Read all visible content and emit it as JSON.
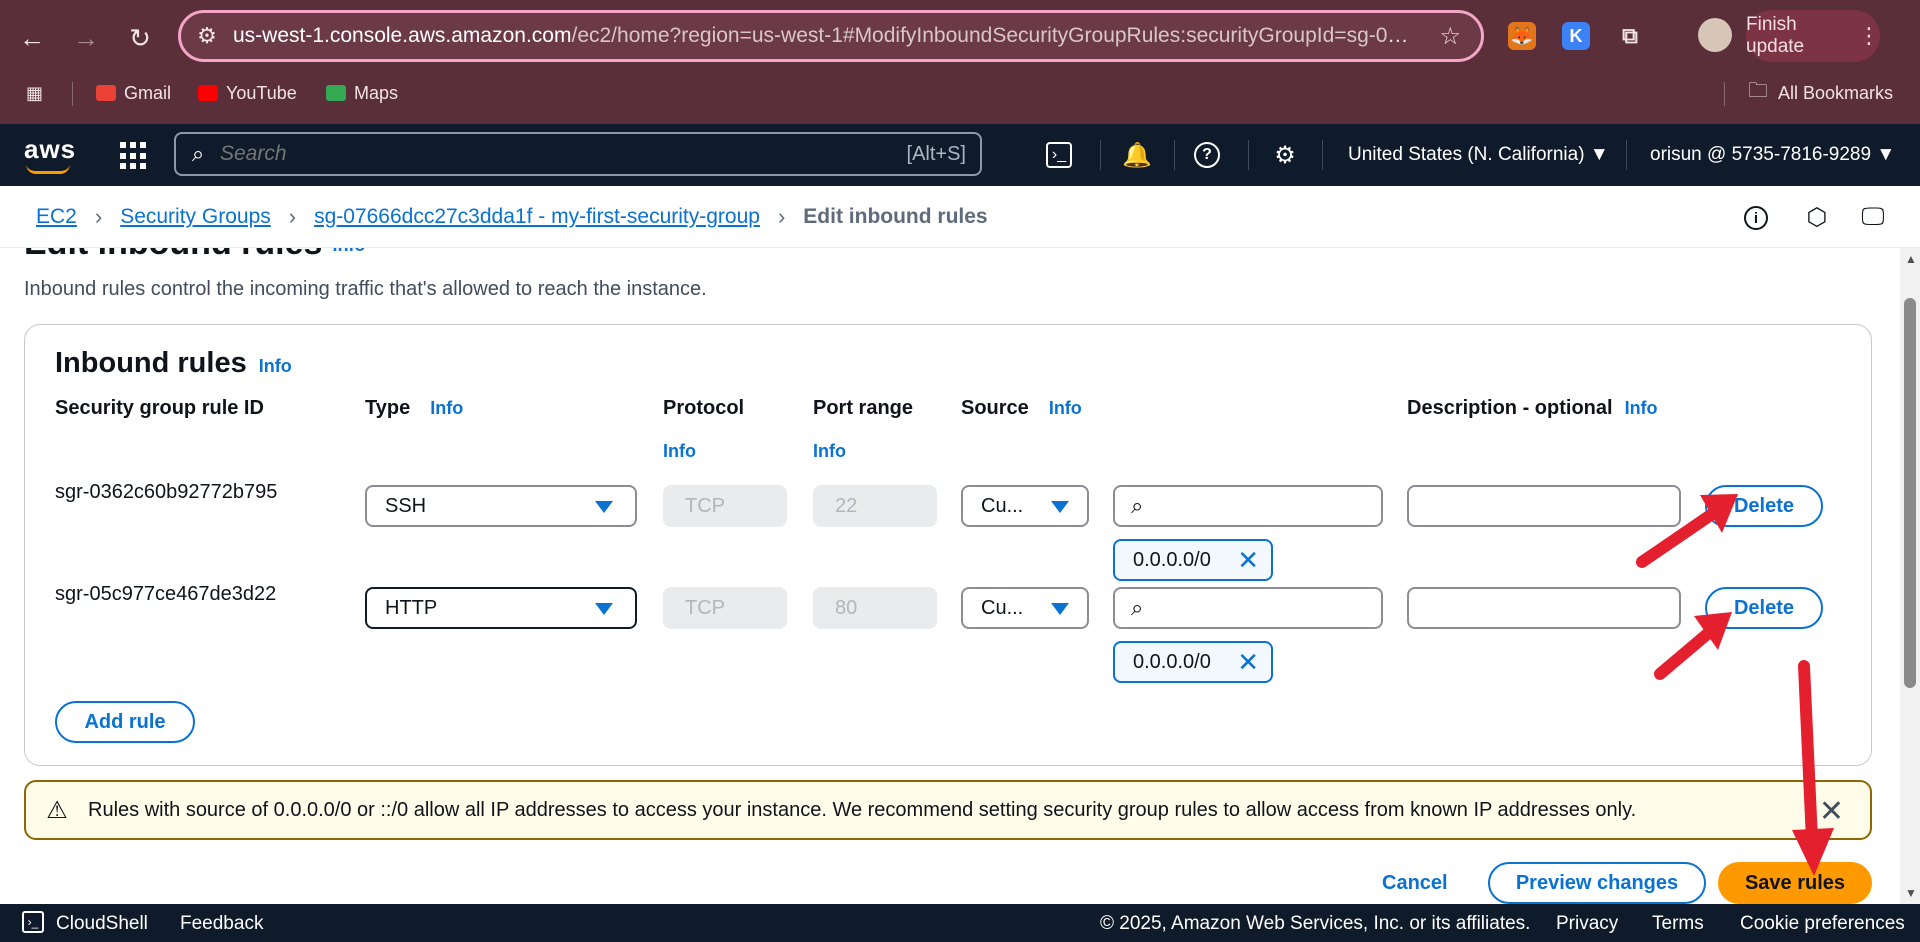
{
  "browser": {
    "url_host": "us-west-1.console.aws.amazon.com",
    "url_rest": "/ec2/home?region=us-west-1#ModifyInboundSecurityGroupRules:securityGroupId=sg-07...",
    "finish_update": "Finish update",
    "bookmarks": [
      "Gmail",
      "YouTube",
      "Maps"
    ],
    "all_bookmarks": "All Bookmarks",
    "ext_k": "K"
  },
  "aws_header": {
    "logo": "aws",
    "search_placeholder": "Search",
    "search_shortcut": "[Alt+S]",
    "region": "United States (N. California) ▼",
    "account": "orisun @ 5735-7816-9289 ▼"
  },
  "breadcrumbs": {
    "ec2": "EC2",
    "security_groups": "Security Groups",
    "group": "sg-07666dcc27c3dda1f - my-first-security-group",
    "current": "Edit inbound rules"
  },
  "page": {
    "title": "Edit inbound rules",
    "info": "Info",
    "description": "Inbound rules control the incoming traffic that's allowed to reach the instance."
  },
  "panel": {
    "title": "Inbound rules",
    "columns": {
      "rule_id": "Security group rule ID",
      "type": "Type",
      "protocol": "Protocol",
      "port_range": "Port range",
      "source": "Source",
      "description": "Description - optional"
    },
    "rows": [
      {
        "id": "sgr-0362c60b92772b795",
        "type": "SSH",
        "protocol": "TCP",
        "port": "22",
        "source": "Cu...",
        "token": "0.0.0.0/0",
        "delete": "Delete"
      },
      {
        "id": "sgr-05c977ce467de3d22",
        "type": "HTTP",
        "protocol": "TCP",
        "port": "80",
        "source": "Cu...",
        "token": "0.0.0.0/0",
        "delete": "Delete"
      }
    ],
    "add_rule": "Add rule"
  },
  "alert": {
    "message": "Rules with source of 0.0.0.0/0 or ::/0 allow all IP addresses to access your instance. We recommend setting security group rules to allow access from known IP addresses only."
  },
  "actions": {
    "cancel": "Cancel",
    "preview": "Preview changes",
    "save": "Save rules"
  },
  "footer": {
    "cloudshell": "CloudShell",
    "feedback": "Feedback",
    "copyright": "© 2025, Amazon Web Services, Inc. or its affiliates.",
    "privacy": "Privacy",
    "terms": "Terms",
    "cookies": "Cookie preferences"
  },
  "colors": {
    "chrome": "#5a2f3a",
    "aws_nav": "#0f1b2a",
    "link": "#0972d3",
    "primary": "#ff9900",
    "annotation_arrow": "#e5202e"
  }
}
